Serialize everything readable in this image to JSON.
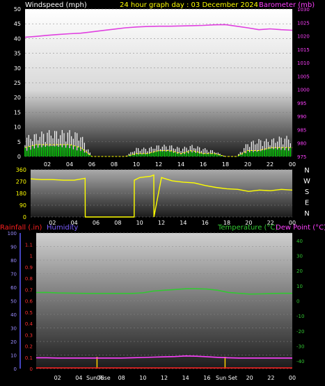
{
  "header": {
    "left_title": "Windspeed (mph)",
    "center_title": "24 hour graph day : 03 December 2024",
    "right_title": "Barometer (mb)"
  },
  "colors": {
    "wind_gust": "#ffffff",
    "wind_avg": "#00c800",
    "wind_avg_line": "#ffff00",
    "pressure": "#e040e0",
    "direction": "#ffff00",
    "temperature": "#32c832",
    "dewpoint": "#ff40ff",
    "humidity": "#9b30ff",
    "rainfall": "#ff2020",
    "sun": "#ffd000"
  },
  "x_tick_labels": [
    "02",
    "04",
    "06",
    "08",
    "10",
    "12",
    "14",
    "16",
    "18",
    "20",
    "22",
    "00"
  ],
  "chart_data": [
    {
      "id": "wind_pressure",
      "type": "line",
      "title": "24 hour graph day : 03 December 2024",
      "ylabel": "Windspeed (mph)",
      "y2label": "Barometer (mb)",
      "ylim": [
        0,
        50
      ],
      "yticks": [
        0,
        5,
        10,
        15,
        20,
        25,
        30,
        35,
        40,
        45,
        50
      ],
      "y2lim": [
        975,
        1030
      ],
      "y2ticks": [
        975,
        980,
        985,
        990,
        995,
        1000,
        1005,
        1010,
        1015,
        1020,
        1025,
        1030
      ],
      "x_hours": [
        0,
        1,
        2,
        3,
        4,
        5,
        6,
        7,
        8,
        9,
        10,
        11,
        12,
        13,
        14,
        15,
        16,
        17,
        18,
        19,
        20,
        21,
        22,
        23,
        24
      ],
      "series": [
        {
          "name": "gust",
          "values": [
            7,
            8,
            9,
            9,
            9,
            8,
            0,
            0,
            0,
            0,
            3,
            3,
            4,
            4,
            3,
            4,
            3,
            2,
            0,
            0,
            5,
            6,
            6,
            7,
            7
          ]
        },
        {
          "name": "average",
          "values": [
            3,
            4,
            4,
            4,
            4,
            3,
            0,
            0,
            0,
            0,
            1,
            1,
            2,
            2,
            1,
            2,
            1,
            1,
            0,
            0,
            2,
            2,
            3,
            3,
            3
          ]
        },
        {
          "name": "pressure",
          "values": [
            1019.5,
            1019.8,
            1020.2,
            1020.5,
            1020.8,
            1021,
            1021.5,
            1022,
            1022.5,
            1023,
            1023.3,
            1023.5,
            1023.6,
            1023.6,
            1023.7,
            1023.8,
            1023.9,
            1024.1,
            1024.2,
            1023.6,
            1023,
            1022.3,
            1022.6,
            1022.3,
            1022.1
          ]
        }
      ]
    },
    {
      "id": "direction",
      "type": "line",
      "ylim": [
        0,
        360
      ],
      "yticks": [
        0,
        90,
        180,
        270,
        360
      ],
      "compass": [
        "N",
        "W",
        "S",
        "E",
        "N"
      ],
      "x_hours": [
        0,
        1,
        2,
        3,
        4,
        5,
        5.01,
        6,
        7,
        8,
        9,
        9.5,
        9.51,
        10,
        11,
        11.3,
        11.31,
        12,
        13,
        14,
        15,
        16,
        17,
        18,
        19,
        20,
        21,
        22,
        23,
        24
      ],
      "series": [
        {
          "name": "direction",
          "values": [
            290,
            285,
            285,
            280,
            280,
            295,
            0,
            0,
            0,
            0,
            0,
            0,
            280,
            300,
            310,
            320,
            0,
            300,
            275,
            265,
            260,
            240,
            225,
            215,
            210,
            195,
            205,
            200,
            210,
            205
          ]
        }
      ]
    },
    {
      "id": "temp_rain",
      "type": "line",
      "ylabel": "Rainfall (.in)",
      "ylabel2": "Humidity",
      "y2label": "Temperature (°C)",
      "y2label2": "Dew Point (°C)",
      "rain_ylim": [
        0,
        1.2
      ],
      "rain_yticks": [
        0,
        0.1,
        0.2,
        0.3,
        0.4,
        0.5,
        0.6,
        0.7,
        0.8,
        0.9,
        1,
        1.1
      ],
      "humidity_ylim": [
        0,
        100
      ],
      "humidity_yticks": [
        0,
        10,
        20,
        30,
        40,
        50,
        60,
        70,
        80,
        90,
        100
      ],
      "temp_ylim": [
        -45,
        45
      ],
      "temp_yticks": [
        -40,
        -30,
        -20,
        -10,
        0,
        10,
        20,
        30,
        40
      ],
      "x_hours": [
        0,
        1,
        2,
        3,
        4,
        5,
        6,
        7,
        8,
        9,
        10,
        11,
        12,
        13,
        14,
        15,
        16,
        17,
        18,
        19,
        20,
        21,
        22,
        23,
        24
      ],
      "sun_labels": [
        "Sun Rise",
        "Sun Set"
      ],
      "sunrise_hour": 5.7,
      "sunset_hour": 17.7,
      "series": [
        {
          "name": "temperature",
          "values": [
            5.5,
            5.6,
            5.2,
            5.1,
            5.0,
            4.9,
            4.9,
            4.9,
            4.9,
            4.9,
            5.3,
            6.5,
            7.0,
            7.5,
            8.0,
            8.0,
            7.8,
            7.0,
            5.6,
            5.0,
            4.5,
            4.6,
            4.8,
            5.0,
            5.0
          ]
        },
        {
          "name": "dewpoint",
          "values": [
            -37.8,
            -37.8,
            -38,
            -38,
            -38,
            -38,
            -38,
            -38,
            -38,
            -37.8,
            -37.6,
            -37.4,
            -37.2,
            -37,
            -36.6,
            -36.8,
            -37.1,
            -37.5,
            -37.8,
            -38,
            -38,
            -38,
            -38,
            -38,
            -38
          ]
        },
        {
          "name": "rainfall",
          "values": [
            0,
            0,
            0,
            0,
            0,
            0,
            0,
            0,
            0,
            0,
            0,
            0,
            0,
            0,
            0,
            0,
            0,
            0,
            0,
            0,
            0,
            0,
            0,
            0,
            0
          ]
        }
      ]
    }
  ]
}
